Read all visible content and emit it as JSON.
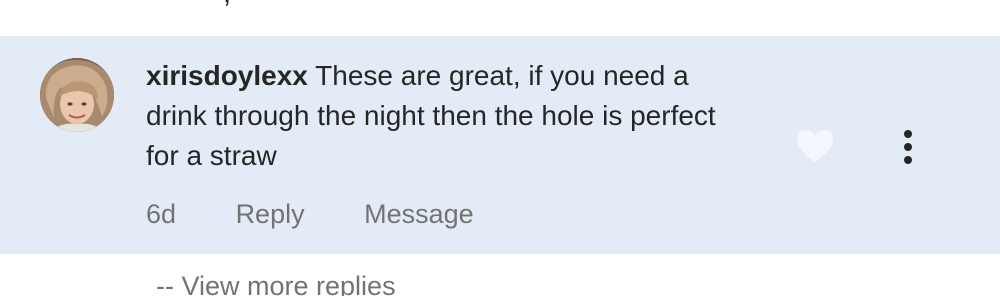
{
  "previous_comment": {
    "partial_text": "·  ·  ·  ·  ·  ·  ·  ·  ·   ,"
  },
  "comment": {
    "username": "xirisdoylexx",
    "text": " These are great, if you need a drink through the night then the hole is perfect for a straw",
    "time": "6d",
    "reply_label": "Reply",
    "message_label": "Message",
    "avatar_icon": "profile-photo",
    "like_icon": "heart-icon",
    "more_icon": "more-options-icon",
    "background_color": "#e3ecf6"
  },
  "view_more_replies": {
    "label": "-- View more replies"
  }
}
